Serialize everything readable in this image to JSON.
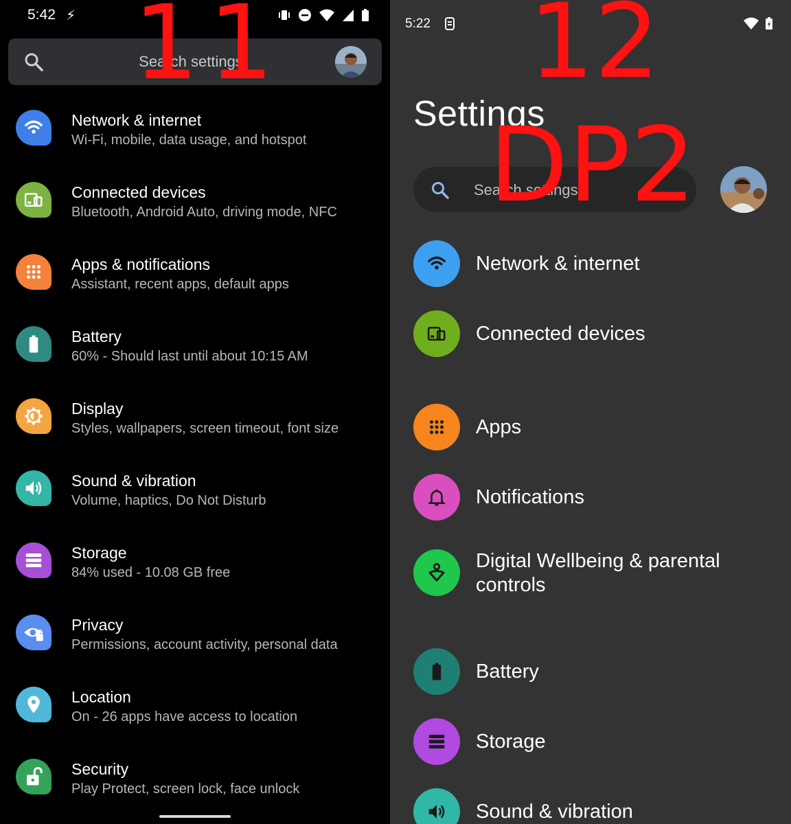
{
  "left": {
    "status": {
      "time": "5:42"
    },
    "search": {
      "placeholder": "Search settings"
    },
    "items": [
      {
        "title": "Network & internet",
        "subtitle": "Wi-Fi, mobile, data usage, and hotspot",
        "icon": "wifi-icon",
        "color": "#3f7fe8"
      },
      {
        "title": "Connected devices",
        "subtitle": "Bluetooth, Android Auto, driving mode, NFC",
        "icon": "devices-icon",
        "color": "#7cb342"
      },
      {
        "title": "Apps & notifications",
        "subtitle": "Assistant, recent apps, default apps",
        "icon": "apps-grid-icon",
        "color": "#f4823a"
      },
      {
        "title": "Battery",
        "subtitle": "60% - Should last until about 10:15 AM",
        "icon": "battery-icon",
        "color": "#2f8b82"
      },
      {
        "title": "Display",
        "subtitle": "Styles, wallpapers, screen timeout, font size",
        "icon": "brightness-icon",
        "color": "#f5a442"
      },
      {
        "title": "Sound & vibration",
        "subtitle": "Volume, haptics, Do Not Disturb",
        "icon": "volume-icon",
        "color": "#35b5a6"
      },
      {
        "title": "Storage",
        "subtitle": "84% used - 10.08 GB free",
        "icon": "storage-icon",
        "color": "#a74fd6"
      },
      {
        "title": "Privacy",
        "subtitle": "Permissions, account activity, personal data",
        "icon": "privacy-eye-icon",
        "color": "#5a8df0"
      },
      {
        "title": "Location",
        "subtitle": "On - 26 apps have access to location",
        "icon": "location-pin-icon",
        "color": "#4fb8d8"
      },
      {
        "title": "Security",
        "subtitle": "Play Protect, screen lock, face unlock",
        "icon": "lock-open-icon",
        "color": "#33a35a"
      }
    ]
  },
  "right": {
    "status": {
      "time": "5:22"
    },
    "title": "Settings",
    "search": {
      "placeholder": "Search settings"
    },
    "items": [
      {
        "title": "Network & internet",
        "icon": "wifi-icon",
        "color": "#3d9ff0"
      },
      {
        "title": "Connected devices",
        "icon": "devices-icon",
        "color": "#6fae1c"
      },
      {
        "title": "Apps",
        "icon": "apps-grid-icon",
        "color": "#f7841d"
      },
      {
        "title": "Notifications",
        "icon": "bell-icon",
        "color": "#d94fc0"
      },
      {
        "title": "Digital Wellbeing & parental controls",
        "icon": "wellbeing-icon",
        "color": "#1fc74b"
      },
      {
        "title": "Battery",
        "icon": "battery-icon",
        "color": "#1f7f75"
      },
      {
        "title": "Storage",
        "icon": "storage-icon",
        "color": "#b04ae0"
      },
      {
        "title": "Sound & vibration",
        "icon": "volume-icon",
        "color": "#2fb8a8"
      }
    ]
  },
  "overlay": {
    "left_label": "11",
    "right_label_1": "12",
    "right_label_2": "DP2"
  }
}
